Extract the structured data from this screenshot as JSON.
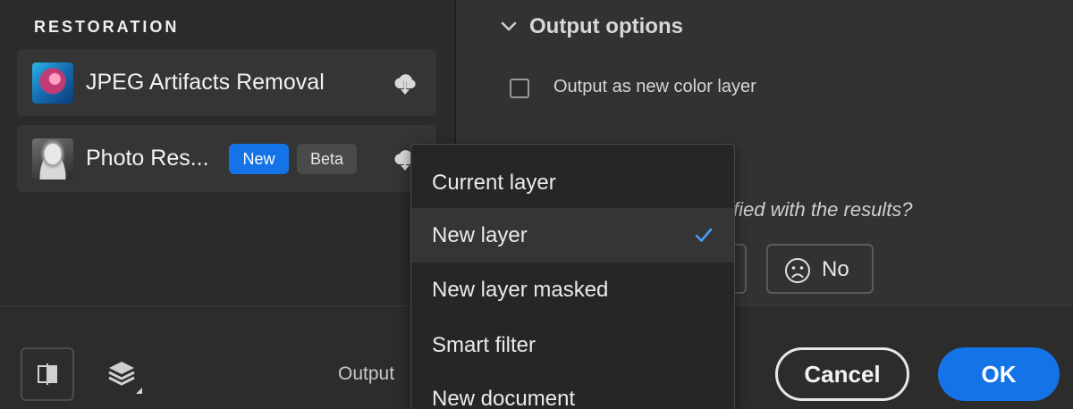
{
  "left_panel": {
    "section_title": "RESTORATION",
    "filters": [
      {
        "name": "JPEG Artifacts Removal",
        "icon": "cloud-download-icon"
      },
      {
        "name": "Photo Res...",
        "badges": [
          "New",
          "Beta"
        ],
        "icon": "cloud-download-icon"
      }
    ]
  },
  "right_panel": {
    "output_options_title": "Output options",
    "checkbox_label": "Output as new color layer",
    "checkbox_checked": false,
    "question": "fied with the results?",
    "no_label": "No"
  },
  "bottom_bar": {
    "output_label": "Output",
    "cancel_label": "Cancel",
    "ok_label": "OK"
  },
  "menu": {
    "items": [
      "Current layer",
      "New layer",
      "New layer masked",
      "Smart filter",
      "New document"
    ],
    "selected": "New layer"
  },
  "colors": {
    "accent": "#1473e6",
    "check": "#4a9cf5"
  }
}
